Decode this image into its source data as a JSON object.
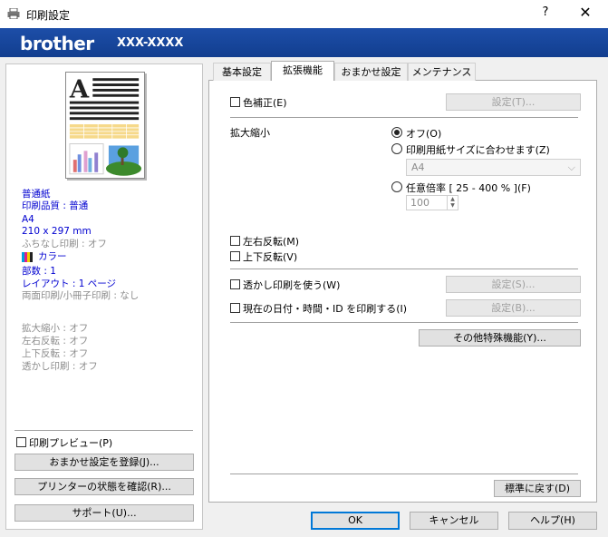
{
  "window": {
    "title": "印刷設定",
    "help": "?",
    "close": "✕"
  },
  "banner": {
    "brand": "brother",
    "model": "XXX-XXXX"
  },
  "summary": {
    "media": "普通紙",
    "quality": "印刷品質 : 普通",
    "paper": "A4",
    "dimensions": "210 x 297 mm",
    "borderless": "ふちなし印刷 : オフ",
    "color": "カラー",
    "copies": "部数 : 1",
    "layout": "レイアウト : 1 ページ",
    "duplex": "両面印刷/小冊子印刷 : なし",
    "scaling": "拡大縮小 : オフ",
    "mirror": "左右反転 : オフ",
    "reverse": "上下反転 : オフ",
    "watermark": "透かし印刷 : オフ"
  },
  "left": {
    "print_preview": "印刷プレビュー(P)",
    "add_profile": "おまかせ設定を登録(J)...",
    "printer_status": "プリンターの状態を確認(R)...",
    "support": "サポート(U)..."
  },
  "tabs": [
    "基本設定",
    "拡張機能",
    "おまかせ設定",
    "メンテナンス"
  ],
  "active_tab": "拡張機能",
  "advanced": {
    "color_adjust": "色補正(E)",
    "settings_t": "設定(T)...",
    "scaling_label": "拡大縮小",
    "opt_off": "オフ(O)",
    "opt_fit": "印刷用紙サイズに合わせます(Z)",
    "paper_select": "A4",
    "opt_free": "任意倍率 [ 25 - 400 % ](F)",
    "free_value": "100",
    "mirror_print": "左右反転(M)",
    "reverse_print": "上下反転(V)",
    "use_watermark": "透かし印刷を使う(W)",
    "settings_s": "設定(S)...",
    "header_footer": "現在の日付・時間・ID を印刷する(I)",
    "settings_b": "設定(B)...",
    "other_features": "その他特殊機能(Y)...",
    "default": "標準に戻す(D)"
  },
  "footer": {
    "ok": "OK",
    "cancel": "キャンセル",
    "help": "ヘルプ(H)"
  },
  "state": {
    "scaling_selected": "オフ(O)"
  },
  "colors": {
    "banner": "#1d4ea8",
    "summary_text": "#0000d0",
    "disabled_text": "#8c8c8c"
  }
}
